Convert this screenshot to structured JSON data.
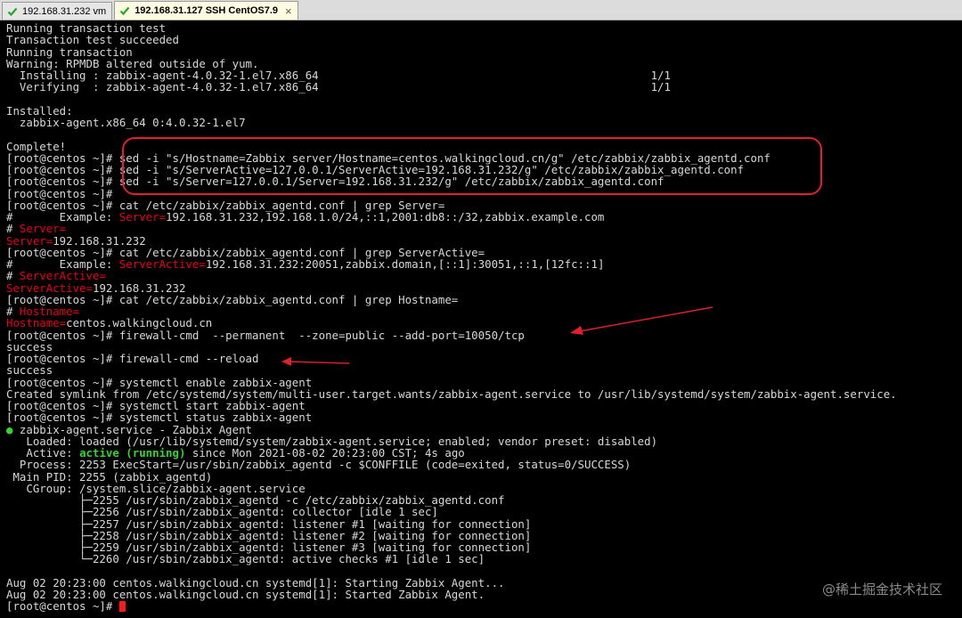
{
  "tabs": [
    {
      "label": "192.168.31.232 vm",
      "active": false
    },
    {
      "label": "192.168.31.127 SSH CentOS7.9",
      "active": true
    }
  ],
  "terminal": {
    "lines": [
      [
        {
          "t": "Running transaction test"
        }
      ],
      [
        {
          "t": "Transaction test succeeded"
        }
      ],
      [
        {
          "t": "Running transaction"
        }
      ],
      [
        {
          "t": "Warning: RPMDB altered outside of yum."
        }
      ],
      [
        {
          "t": "  Installing : zabbix-agent-4.0.32-1.el7.x86_64                                                  1/1"
        }
      ],
      [
        {
          "t": "  Verifying  : zabbix-agent-4.0.32-1.el7.x86_64                                                  1/1"
        }
      ],
      [
        {
          "t": ""
        }
      ],
      [
        {
          "t": "Installed:"
        }
      ],
      [
        {
          "t": "  zabbix-agent.x86_64 0:4.0.32-1.el7"
        }
      ],
      [
        {
          "t": ""
        }
      ],
      [
        {
          "t": "Complete!"
        }
      ],
      [
        {
          "t": "[root@centos ~]# sed -i \"s/Hostname=Zabbix server/Hostname=centos.walkingcloud.cn/g\" /etc/zabbix/zabbix_agentd.conf"
        }
      ],
      [
        {
          "t": "[root@centos ~]# sed -i \"s/ServerActive=127.0.0.1/ServerActive=192.168.31.232/g\" /etc/zabbix/zabbix_agentd.conf"
        }
      ],
      [
        {
          "t": "[root@centos ~]# sed -i \"s/Server=127.0.0.1/Server=192.168.31.232/g\" /etc/zabbix/zabbix_agentd.conf"
        }
      ],
      [
        {
          "t": "[root@centos ~]# "
        }
      ],
      [
        {
          "t": "[root@centos ~]# cat /etc/zabbix/zabbix_agentd.conf | grep Server="
        }
      ],
      [
        {
          "t": "#       Example: "
        },
        {
          "t": "Server=",
          "c": "hl"
        },
        {
          "t": "192.168.31.232,192.168.1.0/24,::1,2001:db8::/32,zabbix.example.com"
        }
      ],
      [
        {
          "t": "# "
        },
        {
          "t": "Server=",
          "c": "hl"
        }
      ],
      [
        {
          "t": "Server=",
          "c": "hl"
        },
        {
          "t": "192.168.31.232"
        }
      ],
      [
        {
          "t": "[root@centos ~]# cat /etc/zabbix/zabbix_agentd.conf | grep ServerActive="
        }
      ],
      [
        {
          "t": "#       Example: "
        },
        {
          "t": "ServerActive=",
          "c": "hl"
        },
        {
          "t": "192.168.31.232:20051,zabbix.domain,[::1]:30051,::1,[12fc::1]"
        }
      ],
      [
        {
          "t": "# "
        },
        {
          "t": "ServerActive=",
          "c": "hl"
        }
      ],
      [
        {
          "t": "ServerActive=",
          "c": "hl"
        },
        {
          "t": "192.168.31.232"
        }
      ],
      [
        {
          "t": "[root@centos ~]# cat /etc/zabbix/zabbix_agentd.conf | grep Hostname="
        }
      ],
      [
        {
          "t": "# "
        },
        {
          "t": "Hostname=",
          "c": "hl"
        }
      ],
      [
        {
          "t": "Hostname=",
          "c": "hl"
        },
        {
          "t": "centos.walkingcloud.cn"
        }
      ],
      [
        {
          "t": "[root@centos ~]# firewall-cmd  --permanent  --zone=public --add-port=10050/tcp"
        }
      ],
      [
        {
          "t": "success"
        }
      ],
      [
        {
          "t": "[root@centos ~]# firewall-cmd --reload"
        }
      ],
      [
        {
          "t": "success"
        }
      ],
      [
        {
          "t": "[root@centos ~]# systemctl enable zabbix-agent"
        }
      ],
      [
        {
          "t": "Created symlink from /etc/systemd/system/multi-user.target.wants/zabbix-agent.service to /usr/lib/systemd/system/zabbix-agent.service."
        }
      ],
      [
        {
          "t": "[root@centos ~]# systemctl start zabbix-agent"
        }
      ],
      [
        {
          "t": "[root@centos ~]# systemctl status zabbix-agent"
        }
      ],
      [
        {
          "t": "●",
          "c": "green"
        },
        {
          "t": " zabbix-agent.service - Zabbix Agent"
        }
      ],
      [
        {
          "t": "   Loaded: loaded (/usr/lib/systemd/system/zabbix-agent.service; enabled; vendor preset: disabled)"
        }
      ],
      [
        {
          "t": "   Active: "
        },
        {
          "t": "active (running)",
          "c": "green-b"
        },
        {
          "t": " since Mon 2021-08-02 20:23:00 CST; 4s ago"
        }
      ],
      [
        {
          "t": "  Process: 2253 ExecStart=/usr/sbin/zabbix_agentd -c $CONFFILE (code=exited, status=0/SUCCESS)"
        }
      ],
      [
        {
          "t": " Main PID: 2255 (zabbix_agentd)"
        }
      ],
      [
        {
          "t": "   CGroup: /system.slice/zabbix-agent.service"
        }
      ],
      [
        {
          "t": "           ├─2255 /usr/sbin/zabbix_agentd -c /etc/zabbix/zabbix_agentd.conf"
        }
      ],
      [
        {
          "t": "           ├─2256 /usr/sbin/zabbix_agentd: collector [idle 1 sec]"
        }
      ],
      [
        {
          "t": "           ├─2257 /usr/sbin/zabbix_agentd: listener #1 [waiting for connection]"
        }
      ],
      [
        {
          "t": "           ├─2258 /usr/sbin/zabbix_agentd: listener #2 [waiting for connection]"
        }
      ],
      [
        {
          "t": "           ├─2259 /usr/sbin/zabbix_agentd: listener #3 [waiting for connection]"
        }
      ],
      [
        {
          "t": "           └─2260 /usr/sbin/zabbix_agentd: active checks #1 [idle 1 sec]"
        }
      ],
      [
        {
          "t": ""
        }
      ],
      [
        {
          "t": "Aug 02 20:23:00 centos.walkingcloud.cn systemd[1]: Starting Zabbix Agent..."
        }
      ],
      [
        {
          "t": "Aug 02 20:23:00 centos.walkingcloud.cn systemd[1]: Started Zabbix Agent."
        }
      ],
      [
        {
          "t": "[root@centos ~]# "
        },
        {
          "t": "",
          "c": "cursor"
        }
      ]
    ]
  },
  "watermark": "@稀土掘金技术社区",
  "colors": {
    "terminal_bg": "#000000",
    "terminal_fg": "#d8d8d8",
    "highlight": "#e6001a",
    "status_green": "#33d533",
    "annotation_red": "#e0202a",
    "tab_check": "#22a822"
  },
  "icons": [
    "check-icon",
    "close-icon"
  ]
}
